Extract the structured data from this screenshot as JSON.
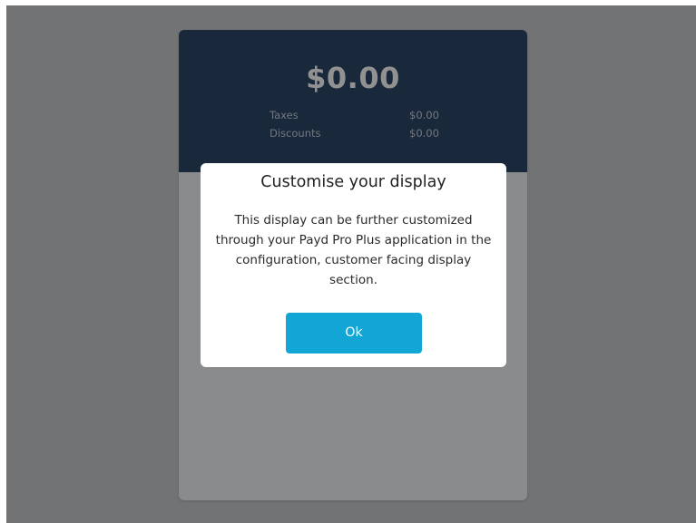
{
  "summary": {
    "total": "$0.00",
    "rows": [
      {
        "label": "Taxes",
        "value": "$0.00"
      },
      {
        "label": "Discounts",
        "value": "$0.00"
      }
    ]
  },
  "dialog": {
    "title": "Customise your display",
    "message": "This display can be further customized through your Payd Pro Plus application in the configuration, customer facing display section.",
    "ok_label": "Ok"
  },
  "colors": {
    "header_background": "#2c4768",
    "overlay": "rgba(0,0,0,0.43)",
    "button": "#12a6d6"
  }
}
